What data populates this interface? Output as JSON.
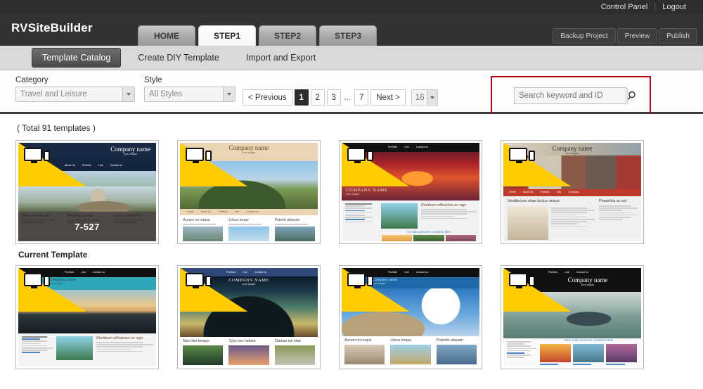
{
  "topbar": {
    "control_panel": "Control Panel",
    "logout": "Logout"
  },
  "header": {
    "brand": "RVSiteBuilder",
    "tabs": [
      {
        "label": "HOME",
        "active": false
      },
      {
        "label": "STEP1",
        "active": true
      },
      {
        "label": "STEP2",
        "active": false
      },
      {
        "label": "STEP3",
        "active": false
      }
    ],
    "actions": [
      "Backup Project",
      "Preview",
      "Publish"
    ]
  },
  "subnav": {
    "items": [
      {
        "label": "Template Catalog",
        "active": true
      },
      {
        "label": "Create DIY Template",
        "active": false
      },
      {
        "label": "Import and Export",
        "active": false
      }
    ]
  },
  "filters": {
    "category": {
      "label": "Category",
      "value": "Travel and Leisure"
    },
    "style": {
      "label": "Style",
      "value": "All Styles"
    }
  },
  "pagination": {
    "previous": "< Previous",
    "next": "Next >",
    "pages": [
      "1",
      "2",
      "3"
    ],
    "dots": "...",
    "last": "7",
    "current": "1",
    "per_page": "16"
  },
  "search": {
    "placeholder": "Search keyword and ID",
    "value": "",
    "icon": "magnifier-icon",
    "highlight_color": "#c00418"
  },
  "content": {
    "total_text": "( Total 91 templates )",
    "current_template_caption": "Current Template",
    "templates": [
      {
        "id": "7-527",
        "company": "Company name",
        "slogan": "your slogan",
        "nav": [
          "About Us",
          "Portfolio",
          "Link",
          "Contact us"
        ],
        "columns": [
          "Vitam at ante sed",
          "Morbi ac consec",
          "Cursus convallis n"
        ],
        "is_current": true
      },
      {
        "company": "Company name",
        "slogan": "your slogan",
        "nav": [
          "Home",
          "About Us",
          "Portfolio",
          "Link",
          "Contact us"
        ],
        "columns": [
          "Accem mi noque",
          "Litoca torqoi",
          "Potenti aliquam"
        ],
        "is_current": false
      },
      {
        "company": "COMPANY NAME",
        "slogan": "your slogan",
        "nav": [
          "Portfolio",
          "Link",
          "Contact us"
        ],
        "heading": "Rentbum efficantur ex sign",
        "footer_link": "mi nulla posuere condime fites",
        "is_current": false
      },
      {
        "company": "Company name",
        "slogan": "your slogan",
        "nav": [
          "Home",
          "About Us",
          "Portfolio",
          "Link",
          "Company"
        ],
        "heading": "Vestibulum vitae luctus neque",
        "sidebar_heading": "Phasellus ac est",
        "is_current": false
      },
      {
        "company": "Company name",
        "slogan": "your slogan",
        "nav": [
          "Portfolio",
          "Link",
          "Contact us"
        ],
        "heading": "Rectibum efficiantur ex sign",
        "is_current": false
      },
      {
        "company": "COMPANY NAME",
        "slogan": "your slogan",
        "nav": [
          "Portfolio",
          "Link",
          "Contact us"
        ],
        "columns": [
          "Nam illor tempor",
          "Typs non habent",
          "Claritas est etiar"
        ],
        "is_current": false
      },
      {
        "company": "Company name",
        "slogan": "your slogan",
        "nav": [
          "Portfolio",
          "Link",
          "Contact us"
        ],
        "columns": [
          "Accum mi noqué",
          "Litoca torque",
          "Potentic aliquam"
        ],
        "is_current": false
      },
      {
        "company": "Company name",
        "slogan": "your slogan",
        "nav": [
          "Portfolio",
          "Link",
          "Contact us"
        ],
        "footer_link": "Nam nulla posuere condime fites",
        "is_current": false
      }
    ]
  }
}
